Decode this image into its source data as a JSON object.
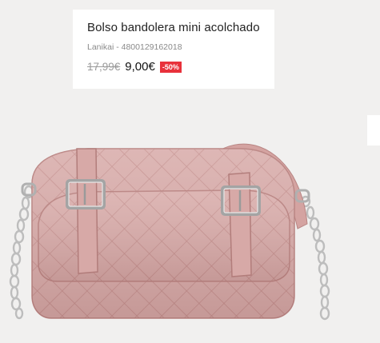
{
  "product": {
    "title": "Bolso bandolera mini acolchado",
    "brand": "Lanikai",
    "separator": " - ",
    "reference": "4800129162018",
    "old_price": "17,99€",
    "new_price": "9,00€",
    "discount": "-50%"
  },
  "colors": {
    "background": "#f1f0ef",
    "discount_badge": "#e8313b",
    "bag": "#d8aaa8"
  }
}
